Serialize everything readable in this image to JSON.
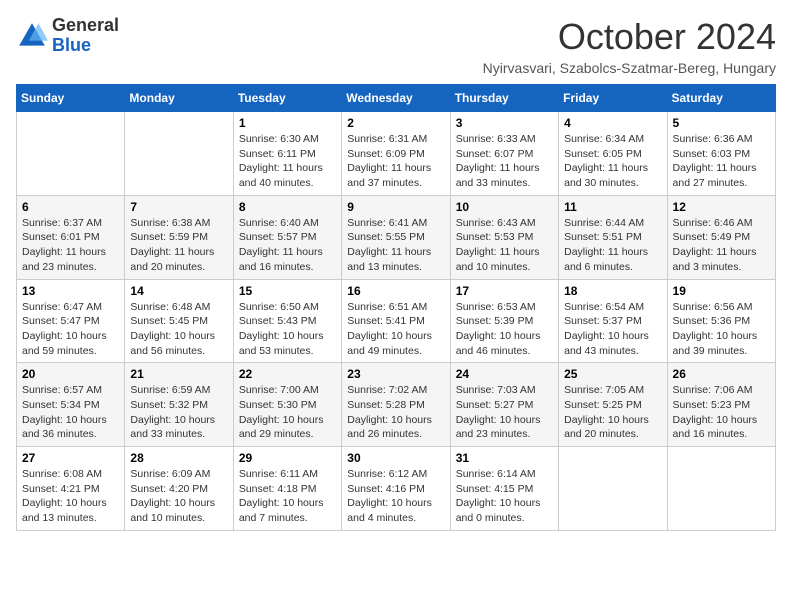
{
  "logo": {
    "general": "General",
    "blue": "Blue"
  },
  "header": {
    "month": "October 2024",
    "location": "Nyirvasvari, Szabolcs-Szatmar-Bereg, Hungary"
  },
  "weekdays": [
    "Sunday",
    "Monday",
    "Tuesday",
    "Wednesday",
    "Thursday",
    "Friday",
    "Saturday"
  ],
  "weeks": [
    [
      {
        "day": "",
        "info": ""
      },
      {
        "day": "",
        "info": ""
      },
      {
        "day": "1",
        "info": "Sunrise: 6:30 AM\nSunset: 6:11 PM\nDaylight: 11 hours and 40 minutes."
      },
      {
        "day": "2",
        "info": "Sunrise: 6:31 AM\nSunset: 6:09 PM\nDaylight: 11 hours and 37 minutes."
      },
      {
        "day": "3",
        "info": "Sunrise: 6:33 AM\nSunset: 6:07 PM\nDaylight: 11 hours and 33 minutes."
      },
      {
        "day": "4",
        "info": "Sunrise: 6:34 AM\nSunset: 6:05 PM\nDaylight: 11 hours and 30 minutes."
      },
      {
        "day": "5",
        "info": "Sunrise: 6:36 AM\nSunset: 6:03 PM\nDaylight: 11 hours and 27 minutes."
      }
    ],
    [
      {
        "day": "6",
        "info": "Sunrise: 6:37 AM\nSunset: 6:01 PM\nDaylight: 11 hours and 23 minutes."
      },
      {
        "day": "7",
        "info": "Sunrise: 6:38 AM\nSunset: 5:59 PM\nDaylight: 11 hours and 20 minutes."
      },
      {
        "day": "8",
        "info": "Sunrise: 6:40 AM\nSunset: 5:57 PM\nDaylight: 11 hours and 16 minutes."
      },
      {
        "day": "9",
        "info": "Sunrise: 6:41 AM\nSunset: 5:55 PM\nDaylight: 11 hours and 13 minutes."
      },
      {
        "day": "10",
        "info": "Sunrise: 6:43 AM\nSunset: 5:53 PM\nDaylight: 11 hours and 10 minutes."
      },
      {
        "day": "11",
        "info": "Sunrise: 6:44 AM\nSunset: 5:51 PM\nDaylight: 11 hours and 6 minutes."
      },
      {
        "day": "12",
        "info": "Sunrise: 6:46 AM\nSunset: 5:49 PM\nDaylight: 11 hours and 3 minutes."
      }
    ],
    [
      {
        "day": "13",
        "info": "Sunrise: 6:47 AM\nSunset: 5:47 PM\nDaylight: 10 hours and 59 minutes."
      },
      {
        "day": "14",
        "info": "Sunrise: 6:48 AM\nSunset: 5:45 PM\nDaylight: 10 hours and 56 minutes."
      },
      {
        "day": "15",
        "info": "Sunrise: 6:50 AM\nSunset: 5:43 PM\nDaylight: 10 hours and 53 minutes."
      },
      {
        "day": "16",
        "info": "Sunrise: 6:51 AM\nSunset: 5:41 PM\nDaylight: 10 hours and 49 minutes."
      },
      {
        "day": "17",
        "info": "Sunrise: 6:53 AM\nSunset: 5:39 PM\nDaylight: 10 hours and 46 minutes."
      },
      {
        "day": "18",
        "info": "Sunrise: 6:54 AM\nSunset: 5:37 PM\nDaylight: 10 hours and 43 minutes."
      },
      {
        "day": "19",
        "info": "Sunrise: 6:56 AM\nSunset: 5:36 PM\nDaylight: 10 hours and 39 minutes."
      }
    ],
    [
      {
        "day": "20",
        "info": "Sunrise: 6:57 AM\nSunset: 5:34 PM\nDaylight: 10 hours and 36 minutes."
      },
      {
        "day": "21",
        "info": "Sunrise: 6:59 AM\nSunset: 5:32 PM\nDaylight: 10 hours and 33 minutes."
      },
      {
        "day": "22",
        "info": "Sunrise: 7:00 AM\nSunset: 5:30 PM\nDaylight: 10 hours and 29 minutes."
      },
      {
        "day": "23",
        "info": "Sunrise: 7:02 AM\nSunset: 5:28 PM\nDaylight: 10 hours and 26 minutes."
      },
      {
        "day": "24",
        "info": "Sunrise: 7:03 AM\nSunset: 5:27 PM\nDaylight: 10 hours and 23 minutes."
      },
      {
        "day": "25",
        "info": "Sunrise: 7:05 AM\nSunset: 5:25 PM\nDaylight: 10 hours and 20 minutes."
      },
      {
        "day": "26",
        "info": "Sunrise: 7:06 AM\nSunset: 5:23 PM\nDaylight: 10 hours and 16 minutes."
      }
    ],
    [
      {
        "day": "27",
        "info": "Sunrise: 6:08 AM\nSunset: 4:21 PM\nDaylight: 10 hours and 13 minutes."
      },
      {
        "day": "28",
        "info": "Sunrise: 6:09 AM\nSunset: 4:20 PM\nDaylight: 10 hours and 10 minutes."
      },
      {
        "day": "29",
        "info": "Sunrise: 6:11 AM\nSunset: 4:18 PM\nDaylight: 10 hours and 7 minutes."
      },
      {
        "day": "30",
        "info": "Sunrise: 6:12 AM\nSunset: 4:16 PM\nDaylight: 10 hours and 4 minutes."
      },
      {
        "day": "31",
        "info": "Sunrise: 6:14 AM\nSunset: 4:15 PM\nDaylight: 10 hours and 0 minutes."
      },
      {
        "day": "",
        "info": ""
      },
      {
        "day": "",
        "info": ""
      }
    ]
  ]
}
